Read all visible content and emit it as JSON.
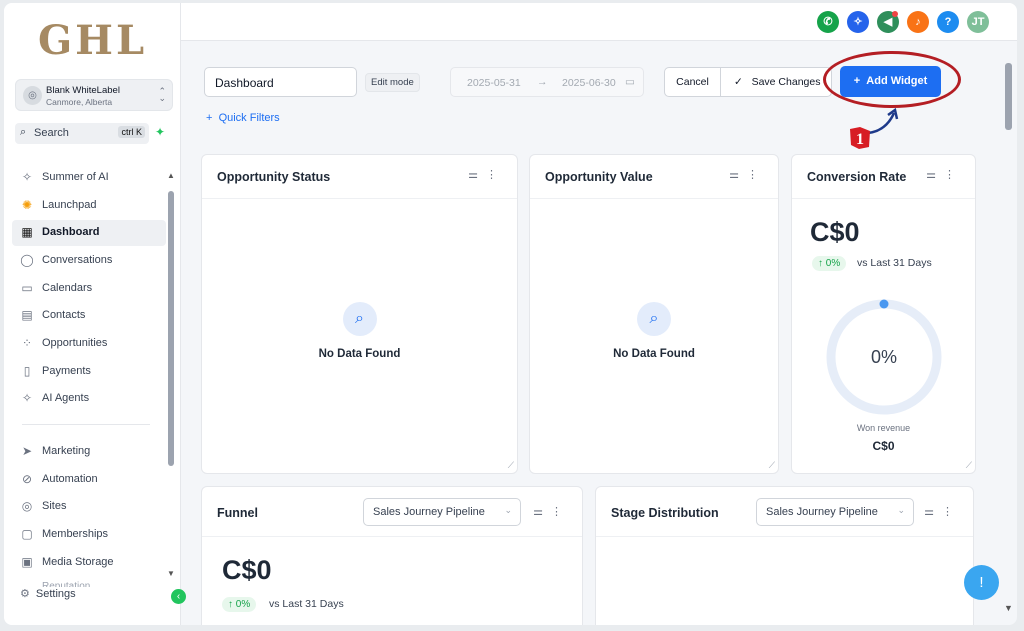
{
  "brand": {
    "logo_text": "GHL"
  },
  "account": {
    "name": "Blank WhiteLabel",
    "location": "Canmore, Alberta"
  },
  "search": {
    "label": "Search",
    "shortcut": "ctrl K"
  },
  "sidebar": {
    "items": [
      {
        "label": "Summer of AI",
        "icon": "sparkle-icon"
      },
      {
        "label": "Launchpad",
        "icon": "rocket-icon"
      },
      {
        "label": "Dashboard",
        "icon": "grid-icon",
        "active": true
      },
      {
        "label": "Conversations",
        "icon": "chat-icon"
      },
      {
        "label": "Calendars",
        "icon": "calendar-icon"
      },
      {
        "label": "Contacts",
        "icon": "contacts-icon"
      },
      {
        "label": "Opportunities",
        "icon": "opportunities-icon"
      },
      {
        "label": "Payments",
        "icon": "payments-icon"
      },
      {
        "label": "AI Agents",
        "icon": "sparkle-icon"
      },
      {
        "label": "Marketing",
        "icon": "send-icon"
      },
      {
        "label": "Automation",
        "icon": "automation-icon"
      },
      {
        "label": "Sites",
        "icon": "globe-icon"
      },
      {
        "label": "Memberships",
        "icon": "memberships-icon"
      },
      {
        "label": "Media Storage",
        "icon": "image-icon"
      }
    ],
    "partial_item": "Reputation",
    "settings": "Settings"
  },
  "topbar": {
    "icons": [
      "phone-icon",
      "magic-icon",
      "megaphone-icon",
      "bell-icon",
      "help-icon"
    ],
    "avatar": "JT",
    "colors": {
      "phone": "#16a34a",
      "magic": "#2563eb",
      "megaphone": "#2f8f5b",
      "bell": "#f97316",
      "help": "#1d8cf0",
      "avatar": "#7fbf99"
    }
  },
  "toolbar": {
    "dashboard_name": "Dashboard",
    "edit_mode": "Edit mode",
    "date_start": "2025-05-31",
    "date_arrow": "→",
    "date_end": "2025-06-30",
    "cancel": "Cancel",
    "save": "Save Changes",
    "add_widget": "Add Widget",
    "quick_filters": "Quick Filters"
  },
  "annotation": {
    "step": "1",
    "color": "#b41e24"
  },
  "widgets": {
    "opportunity_status": {
      "title": "Opportunity Status",
      "empty": "No Data Found"
    },
    "opportunity_value": {
      "title": "Opportunity Value",
      "empty": "No Data Found"
    },
    "conversion_rate": {
      "title": "Conversion Rate",
      "value": "C$0",
      "change": "↑ 0%",
      "compare": "vs Last 31 Days",
      "gauge": "0%",
      "gauge_value": 0,
      "footer_label": "Won revenue",
      "footer_value": "C$0"
    },
    "funnel": {
      "title": "Funnel",
      "pipeline": "Sales Journey Pipeline",
      "value": "C$0",
      "change": "↑ 0%",
      "compare": "vs Last 31 Days"
    },
    "stage_distribution": {
      "title": "Stage Distribution",
      "pipeline": "Sales Journey Pipeline"
    }
  },
  "accent": "#1d6ef2"
}
